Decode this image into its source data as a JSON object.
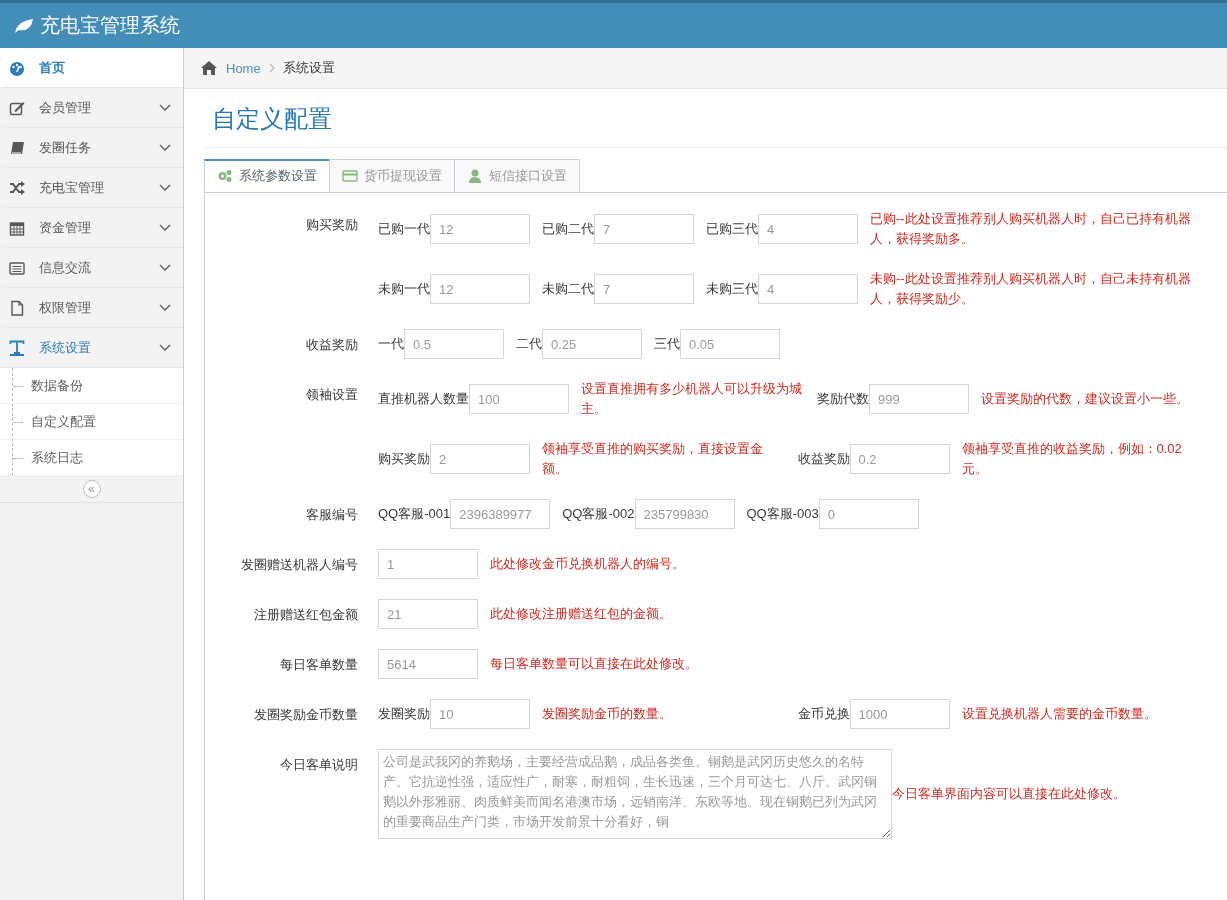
{
  "app_title": "充电宝管理系统",
  "sidebar": {
    "items": [
      {
        "label": "首页",
        "kind": "link",
        "selected": true,
        "expanded": false
      },
      {
        "label": "会员管理",
        "kind": "menu",
        "selected": false,
        "expanded": false
      },
      {
        "label": "发圈任务",
        "kind": "menu",
        "selected": false,
        "expanded": false
      },
      {
        "label": "充电宝管理",
        "kind": "menu",
        "selected": false,
        "expanded": false
      },
      {
        "label": "资金管理",
        "kind": "menu",
        "selected": false,
        "expanded": false
      },
      {
        "label": "信息交流",
        "kind": "menu",
        "selected": false,
        "expanded": false
      },
      {
        "label": "权限管理",
        "kind": "menu",
        "selected": false,
        "expanded": false
      },
      {
        "label": "系统设置",
        "kind": "menu",
        "selected": false,
        "expanded": true,
        "children": [
          {
            "label": "数据备份",
            "selected": false
          },
          {
            "label": "自定义配置",
            "selected": false
          },
          {
            "label": "系统日志",
            "selected": false
          }
        ]
      }
    ]
  },
  "breadcrumb": [
    "Home",
    "系统设置"
  ],
  "page_title": "自定义配置",
  "tabs": [
    {
      "label": "系统参数设置",
      "selected": true
    },
    {
      "label": "货币提现设置",
      "selected": false
    },
    {
      "label": "短信接口设置",
      "selected": false
    }
  ],
  "form": [
    {
      "label": "购买奖励",
      "groups": [
        [
          {
            "kind": "text",
            "text": "已购一代"
          },
          {
            "kind": "input",
            "value": "12"
          },
          {
            "kind": "text",
            "text": "已购二代"
          },
          {
            "kind": "input",
            "value": "7"
          },
          {
            "kind": "text",
            "text": "已购三代"
          },
          {
            "kind": "input",
            "value": "4"
          },
          {
            "kind": "hint",
            "text": "已购--此处设置推荐别人购买机器人时，自己已持有机器人，获得奖励多。"
          }
        ],
        [
          {
            "kind": "text",
            "text": "未购一代"
          },
          {
            "kind": "input",
            "value": "12"
          },
          {
            "kind": "text",
            "text": "未购二代"
          },
          {
            "kind": "input",
            "value": "7"
          },
          {
            "kind": "text",
            "text": "未购三代"
          },
          {
            "kind": "input",
            "value": "4"
          },
          {
            "kind": "hint",
            "text": "未购--此处设置推荐别人购买机器人时，自己未持有机器人，获得奖励少。"
          }
        ]
      ]
    },
    {
      "label": "收益奖励",
      "groups": [
        [
          {
            "kind": "text",
            "text": "一代"
          },
          {
            "kind": "input",
            "value": "0.5"
          },
          {
            "kind": "text",
            "text": "二代"
          },
          {
            "kind": "input",
            "value": "0.25"
          },
          {
            "kind": "text",
            "text": "三代"
          },
          {
            "kind": "input",
            "value": "0.05"
          }
        ]
      ]
    },
    {
      "label": "领袖设置",
      "groups": [
        [
          {
            "kind": "text",
            "text": "直推机器人数量"
          },
          {
            "kind": "input",
            "value": "100"
          },
          {
            "kind": "hint",
            "text": "设置直推拥有多少机器人可以升级为城主。"
          },
          {
            "kind": "text",
            "text": "奖励代数"
          },
          {
            "kind": "input",
            "value": "999"
          },
          {
            "kind": "hint",
            "text": "设置奖励的代数，建议设置小一些。"
          }
        ],
        [
          {
            "kind": "text",
            "text": "购买奖励"
          },
          {
            "kind": "input",
            "value": "2"
          },
          {
            "kind": "hint",
            "text": "领袖享受直推的购买奖励，直接设置金额。"
          },
          {
            "kind": "text",
            "text": "收益奖励"
          },
          {
            "kind": "input",
            "value": "0.2"
          },
          {
            "kind": "hint",
            "text": "领袖享受直推的收益奖励，例如：0.02元。"
          }
        ]
      ]
    },
    {
      "label": "客服编号",
      "groups": [
        [
          {
            "kind": "text",
            "text": "QQ客服-001"
          },
          {
            "kind": "input",
            "value": "2396389977"
          },
          {
            "kind": "text",
            "text": "QQ客服-002"
          },
          {
            "kind": "input",
            "value": "235799830"
          },
          {
            "kind": "text",
            "text": "QQ客服-003"
          },
          {
            "kind": "input",
            "value": "0"
          }
        ]
      ]
    },
    {
      "label": "发圈赠送机器人编号",
      "groups": [
        [
          {
            "kind": "input",
            "value": "1"
          },
          {
            "kind": "hint",
            "text": "此处修改金币兑换机器人的编号。"
          }
        ]
      ]
    },
    {
      "label": "注册赠送红包金额",
      "groups": [
        [
          {
            "kind": "input",
            "value": "21"
          },
          {
            "kind": "hint",
            "text": "此处修改注册赠送红包的金额。"
          }
        ]
      ]
    },
    {
      "label": "每日客单数量",
      "groups": [
        [
          {
            "kind": "input",
            "value": "5614"
          },
          {
            "kind": "hint",
            "text": "每日客单数量可以直接在此处修改。"
          }
        ]
      ]
    },
    {
      "label": "发圈奖励金币数量",
      "groups": [
        [
          {
            "kind": "text",
            "text": "发圈奖励"
          },
          {
            "kind": "input",
            "value": "10"
          },
          {
            "kind": "hint",
            "text": "发圈奖励金币的数量。"
          },
          {
            "kind": "text",
            "text": "金币兑换"
          },
          {
            "kind": "input",
            "value": "1000"
          },
          {
            "kind": "hint",
            "text": "设置兑换机器人需要的金币数量。"
          }
        ]
      ]
    },
    {
      "label": "今日客单说明",
      "groups": [
        [
          {
            "kind": "textarea",
            "value": "公司是武我冈的养鹅场，主要经营成品鹅，成品各类鱼。铜鹅是武冈历史悠久的名特产。它抗逆性强，适应性广，耐寒，耐粗饲，生长迅速，三个月可达七、八斤。武冈铜鹅以外形雅丽、肉质鲜美而闻名港澳市场，远销南洋、东欧等地。现在铜鹅已列为武冈的重要商品生产门类，市场开发前景十分看好，铜"
          },
          {
            "kind": "hint",
            "text": "今日客单界面内容可以直接在此处修改。"
          }
        ]
      ]
    }
  ]
}
